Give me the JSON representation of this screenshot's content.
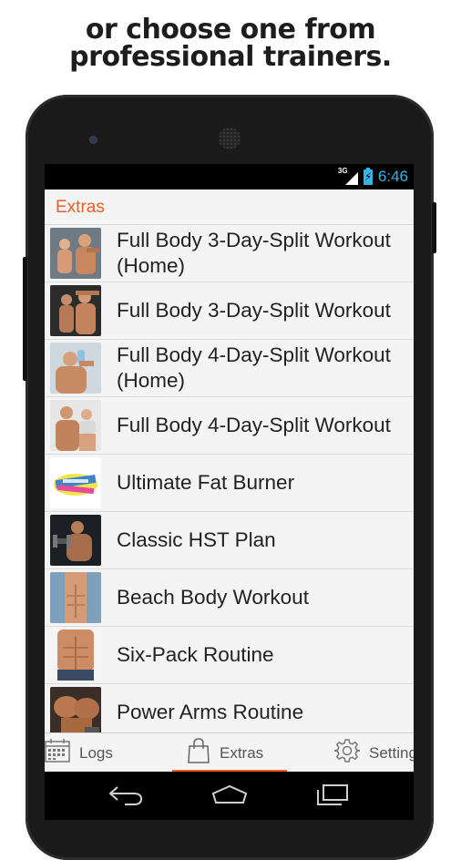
{
  "promo": {
    "line1": "or choose one from",
    "line2": "professional trainers."
  },
  "status_bar": {
    "network": "3G",
    "time": "6:46"
  },
  "action_bar": {
    "title": "Extras"
  },
  "workouts": [
    {
      "label": "Full Body 3-Day-Split Workout\n(Home)",
      "thumb": "couple-flex"
    },
    {
      "label": "Full Body 3-Day-Split Workout",
      "thumb": "couple-pose"
    },
    {
      "label": "Full Body 4-Day-Split Workout\n(Home)",
      "thumb": "man-drinking"
    },
    {
      "label": "Full Body 4-Day-Split Workout",
      "thumb": "couple-smile"
    },
    {
      "label": "Ultimate Fat Burner",
      "thumb": "measuring-tape"
    },
    {
      "label": "Classic HST Plan",
      "thumb": "dumbbell-curl"
    },
    {
      "label": "Beach Body Workout",
      "thumb": "abs-shirt"
    },
    {
      "label": "Six-Pack Routine",
      "thumb": "six-pack"
    },
    {
      "label": "Power Arms Routine",
      "thumb": "arms"
    }
  ],
  "bottom_tabs": [
    {
      "label": "Logs",
      "icon": "calendar-icon"
    },
    {
      "label": "Extras",
      "icon": "shopping-bag-icon",
      "active": true
    },
    {
      "label": "Settings",
      "icon": "gear-icon"
    }
  ],
  "colors": {
    "accent": "#f25b22",
    "status_blue": "#33b5e5"
  }
}
